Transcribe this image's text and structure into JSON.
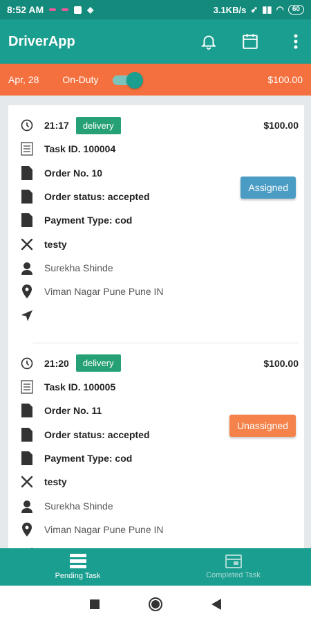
{
  "status_bar": {
    "time": "8:52 AM",
    "net_speed": "3.1KB/s",
    "battery": "60"
  },
  "app_bar": {
    "title": "DriverApp",
    "icons": [
      "bell-icon",
      "calendar-icon",
      "more-vert-icon"
    ]
  },
  "duty_bar": {
    "date": "Apr, 28",
    "status_label": "On-Duty",
    "on_duty": true,
    "amount": "$100.00"
  },
  "tasks": [
    {
      "time": "21:17",
      "type": "delivery",
      "price": "$100.00",
      "task_id": "Task ID. 100004",
      "order_no": "Order No. 10",
      "order_status": "Order status: accepted",
      "payment_type": "Payment Type: cod",
      "restaurant": "testy",
      "customer": "Surekha Shinde",
      "address": "Viman Nagar Pune Pune IN",
      "assignment": "Assigned",
      "assignment_color": "#4a9cc4"
    },
    {
      "time": "21:20",
      "type": "delivery",
      "price": "$100.00",
      "task_id": "Task ID. 100005",
      "order_no": "Order No. 11",
      "order_status": "Order status: accepted",
      "payment_type": "Payment Type: cod",
      "restaurant": "testy",
      "customer": "Surekha Shinde",
      "address": "Viman Nagar Pune Pune IN",
      "assignment": "Unassigned",
      "assignment_color": "#f4824a"
    }
  ],
  "bottom_nav": {
    "items": [
      {
        "label": "Pending Task",
        "icon": "list-icon",
        "active": true
      },
      {
        "label": "Completed Task",
        "icon": "card-icon",
        "active": false
      }
    ]
  },
  "colors": {
    "primary": "#1a9e8f",
    "accent": "#f4713f",
    "badge": "#26a175"
  }
}
